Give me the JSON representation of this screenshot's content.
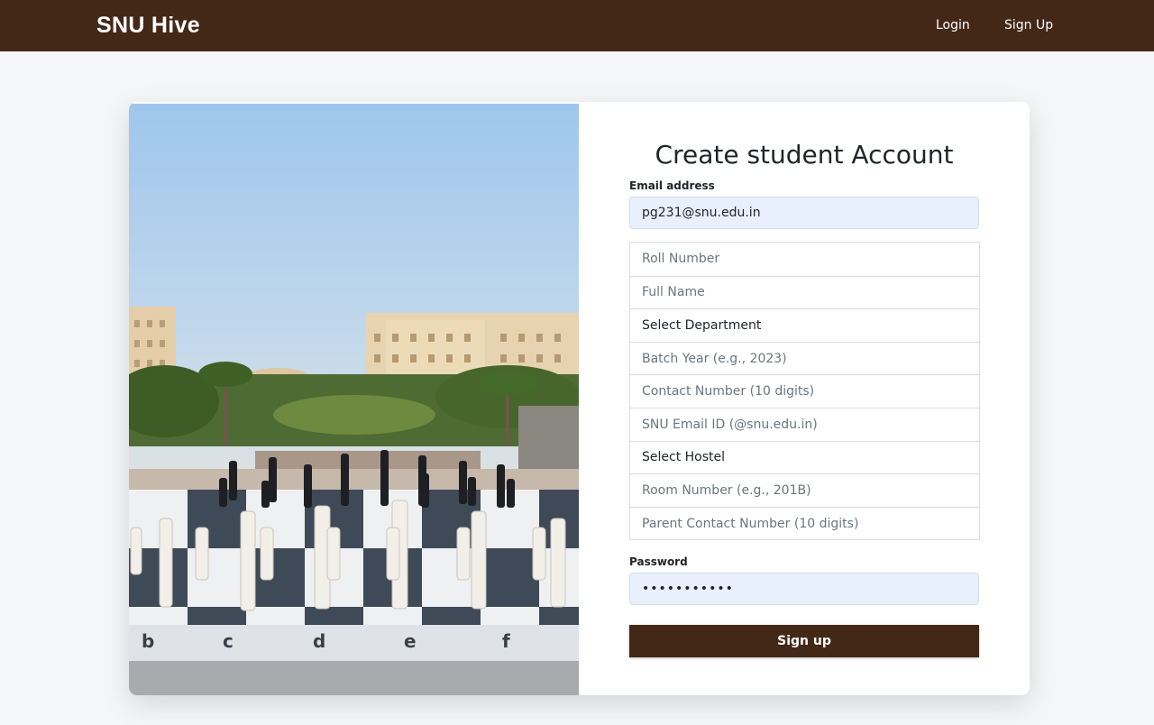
{
  "app": {
    "brand": "SNU Hive",
    "nav": {
      "login": "Login",
      "signup": "Sign Up"
    }
  },
  "colors": {
    "accent": "#432818",
    "input_fill": "#e8f0fe",
    "page_bg": "#f5f6f8"
  },
  "photo": {
    "board_letters": [
      "b",
      "c",
      "d",
      "e",
      "f"
    ]
  },
  "form": {
    "title": "Create student Account",
    "email": {
      "label": "Email address",
      "value": "pg231@snu.edu.in"
    },
    "fields": [
      {
        "placeholder": "Roll Number",
        "value": ""
      },
      {
        "placeholder": "Full Name",
        "value": ""
      },
      {
        "placeholder": "Select Department",
        "value": "Select Department",
        "type": "select"
      },
      {
        "placeholder": "Batch Year (e.g., 2023)",
        "value": ""
      },
      {
        "placeholder": "Contact Number (10 digits)",
        "value": ""
      },
      {
        "placeholder": "SNU Email ID (@snu.edu.in)",
        "value": ""
      },
      {
        "placeholder": "Select Hostel",
        "value": "Select Hostel",
        "type": "select"
      },
      {
        "placeholder": "Room Number (e.g., 201B)",
        "value": ""
      },
      {
        "placeholder": "Parent Contact Number (10 digits)",
        "value": ""
      }
    ],
    "password": {
      "label": "Password",
      "value": "•••••••••••"
    },
    "submit": "Sign up"
  }
}
